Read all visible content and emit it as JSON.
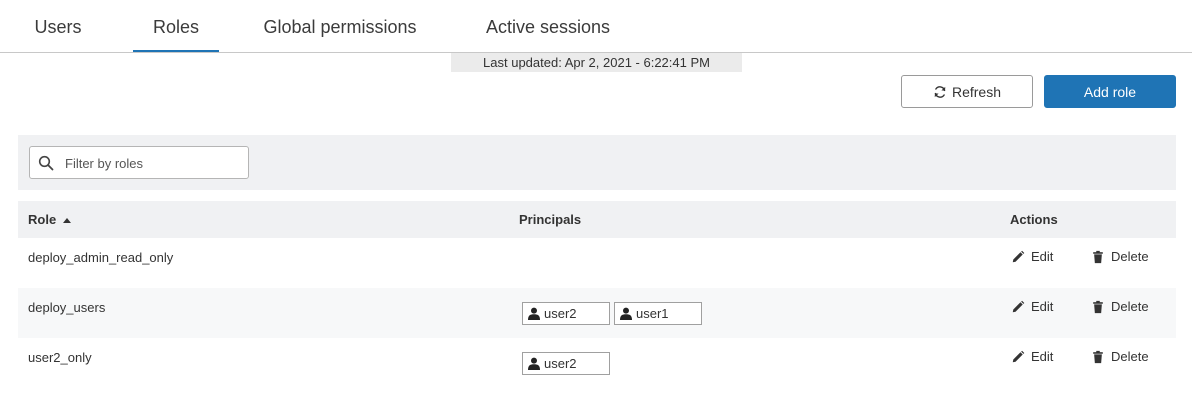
{
  "tabs": [
    {
      "label": "Users",
      "active": false
    },
    {
      "label": "Roles",
      "active": true
    },
    {
      "label": "Global permissions",
      "active": false
    },
    {
      "label": "Active sessions",
      "active": false
    }
  ],
  "last_updated": "Last updated: Apr 2, 2021 - 6:22:41 PM",
  "toolbar": {
    "refresh_label": "Refresh",
    "refresh_icon": "refresh-icon",
    "add_role_label": "Add role"
  },
  "filter": {
    "placeholder": "Filter by roles",
    "value": "",
    "icon": "search-icon"
  },
  "table": {
    "columns": {
      "role": "Role",
      "principals": "Principals",
      "actions": "Actions"
    },
    "sort": {
      "column": "Role",
      "direction": "ascending"
    },
    "rows": [
      {
        "role": "deploy_admin_read_only",
        "principals": [],
        "edit_label": "Edit",
        "delete_label": "Delete"
      },
      {
        "role": "deploy_users",
        "principals": [
          "user2",
          "user1"
        ],
        "edit_label": "Edit",
        "delete_label": "Delete"
      },
      {
        "role": "user2_only",
        "principals": [
          "user2"
        ],
        "edit_label": "Edit",
        "delete_label": "Delete"
      }
    ]
  },
  "colors": {
    "accent": "#1f74b5",
    "header_bg": "#f0f1f3",
    "banner_bg": "#ebebeb"
  }
}
